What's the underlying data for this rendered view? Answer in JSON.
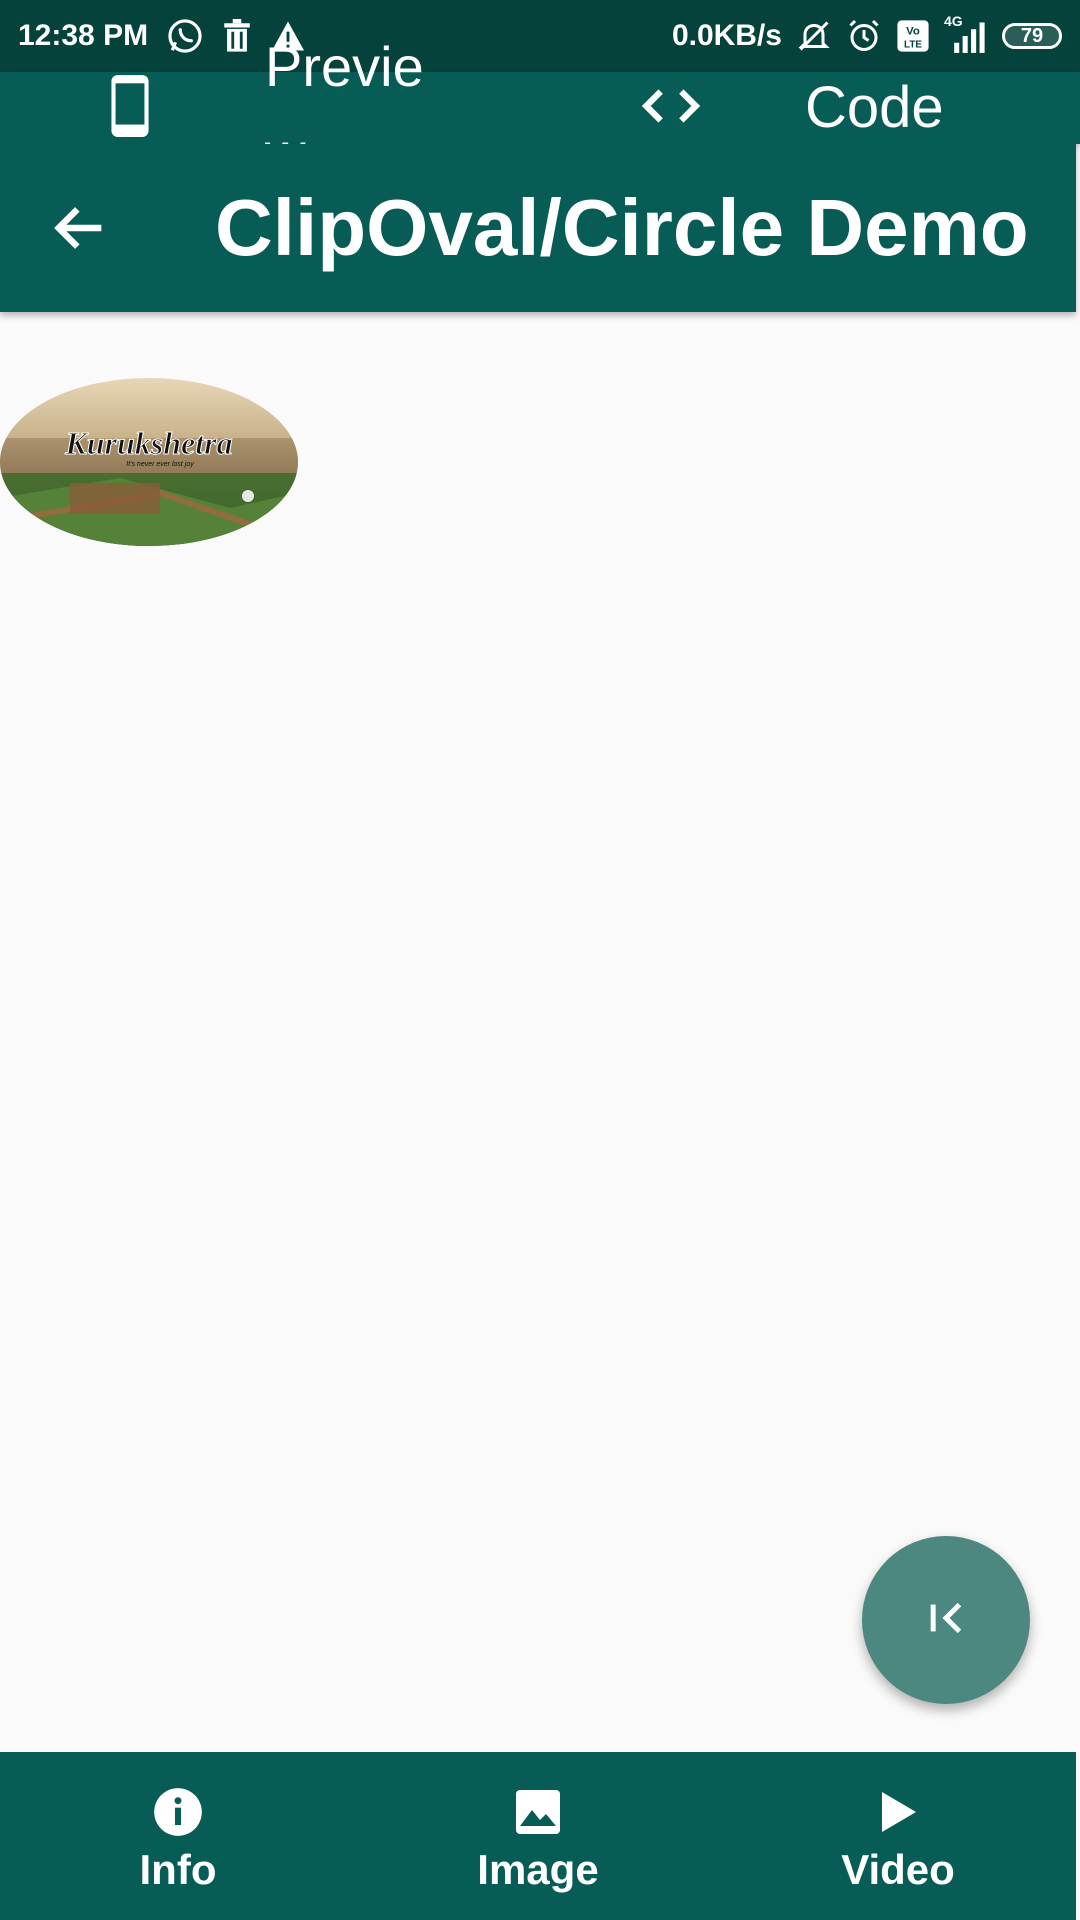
{
  "status_bar": {
    "time": "12:38 PM",
    "network_speed": "0.0KB/s",
    "network_type": "4G",
    "volte": "Vo LTE",
    "battery": "79",
    "icons": [
      "whatsapp-icon",
      "trash-icon",
      "warning-icon",
      "mute-icon",
      "alarm-icon",
      "volte-icon",
      "signal-icon",
      "battery-icon"
    ]
  },
  "toggle_bar": {
    "preview_label": "Preview",
    "code_label": "Code",
    "icons": [
      "phone-icon",
      "code-brackets-icon"
    ]
  },
  "app_bar": {
    "title": "ClipOval/Circle Demo",
    "back_icon": "arrow-back-icon"
  },
  "content": {
    "image_caption": "Kurukshetra",
    "image_subcaption": "It's never ever lost joy"
  },
  "fab": {
    "icon": "first-page-icon"
  },
  "bottom_nav": {
    "items": [
      {
        "label": "Info",
        "icon": "info-icon"
      },
      {
        "label": "Image",
        "icon": "image-icon"
      },
      {
        "label": "Video",
        "icon": "play-icon"
      }
    ]
  },
  "colors": {
    "status_bar": "#05423c",
    "primary": "#075d55",
    "fab": "#4c8880",
    "background": "#fafafa"
  }
}
